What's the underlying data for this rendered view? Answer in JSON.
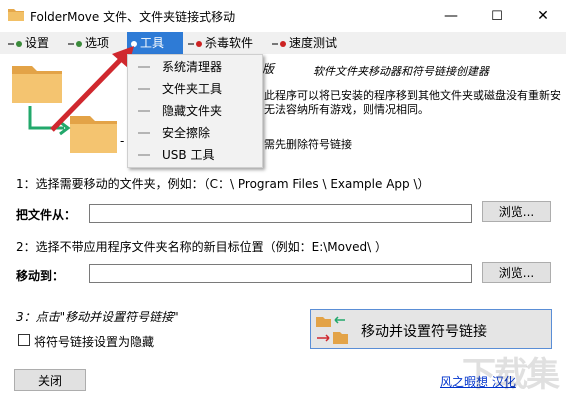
{
  "window": {
    "title": "FolderMove 文件、文件夹链接式移动",
    "controls": {
      "minimize": "—",
      "maximize": "☐",
      "close": "✕"
    }
  },
  "menubar": {
    "items": [
      {
        "label": "设置",
        "dot_color": "#3a8a3a"
      },
      {
        "label": "选项",
        "dot_color": "#3a8a3a"
      },
      {
        "label": "工具",
        "dot_color": "#ffffff",
        "active": true
      },
      {
        "label": "杀毒软件",
        "dot_color": "#cc2222"
      },
      {
        "label": "速度测试",
        "dot_color": "#cc2222"
      }
    ]
  },
  "tools_menu": {
    "items": [
      "系统清理器",
      "文件夹工具",
      "隐藏文件夹",
      "安全擦除",
      "USB 工具"
    ]
  },
  "header": {
    "version_suffix": "版",
    "subtitle": "软件文件夹移动器和符号链接创建器",
    "desc_line1": "此程序可以将已安装的程序移到其他文件夹或磁盘没有重新安",
    "desc_line2": "无法容纳所有游戏，则情况相同。",
    "desc_line3": "需先删除符号链接",
    "dash_label": "-"
  },
  "step1": {
    "instruction": "1：选择需要移动的文件夹，例如：（C：\\ Program Files \\ Example App \\）",
    "field_label": "把文件从：",
    "field_value": "",
    "browse_label": "浏览..."
  },
  "step2": {
    "instruction": "2：选择不带应用程序文件夹名称的新目标位置（例如：E:\\Moved\\ ）",
    "field_label": "移动到：",
    "field_value": "",
    "browse_label": "浏览..."
  },
  "step3": {
    "instruction": "3：点击\"移动并设置符号链接\"",
    "checkbox_label": "将符号链接设置为隐藏",
    "checkbox_checked": false,
    "main_button_label": "移动并设置符号链接"
  },
  "footer": {
    "close_label": "关闭",
    "credit_link": "风之暇想  汉化"
  },
  "watermark": "下载集"
}
